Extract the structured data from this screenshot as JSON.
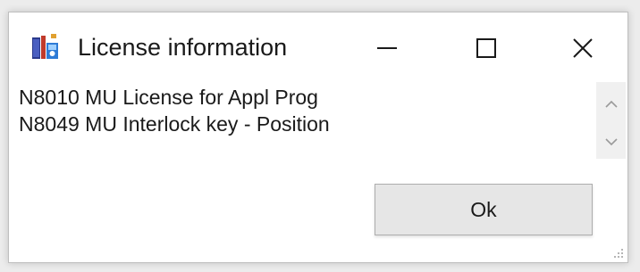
{
  "window": {
    "title": "License information",
    "icon": "app-icon"
  },
  "caption_buttons": {
    "minimize": "minimize-icon",
    "maximize": "maximize-icon",
    "close": "close-icon"
  },
  "content": {
    "lines": [
      "N8010 MU License for Appl Prog",
      "N8049 MU Interlock key - Position"
    ]
  },
  "scrollbar": {
    "up_icon": "chevron-up-icon",
    "down_icon": "chevron-down-icon"
  },
  "footer": {
    "ok_label": "Ok"
  },
  "colors": {
    "window_bg": "#ffffff",
    "button_bg": "#e6e6e6",
    "button_border": "#adadad",
    "scrollbar_bg": "#f0f0f0"
  }
}
